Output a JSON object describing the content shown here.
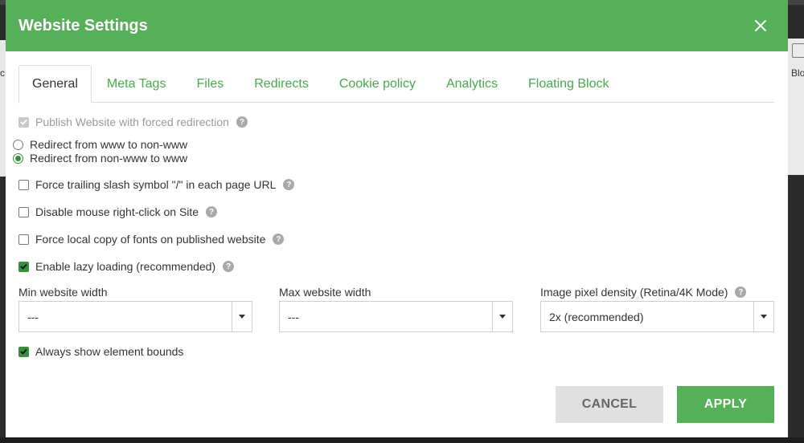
{
  "background": {
    "left_fragment": "c",
    "right_fragment": "Blo"
  },
  "modal": {
    "title": "Website Settings",
    "tabs": [
      {
        "label": "General"
      },
      {
        "label": "Meta Tags"
      },
      {
        "label": "Files"
      },
      {
        "label": "Redirects"
      },
      {
        "label": "Cookie policy"
      },
      {
        "label": "Analytics"
      },
      {
        "label": "Floating Block"
      }
    ],
    "active_tab": "General"
  },
  "general": {
    "publish_forced_redirection": {
      "label": "Publish Website with forced redirection",
      "checked": true,
      "disabled": true
    },
    "redirect_options": [
      {
        "label": "Redirect from www to non-www",
        "selected": false
      },
      {
        "label": "Redirect from non-www to www",
        "selected": true
      }
    ],
    "trailing_slash": {
      "label": "Force trailing slash symbol \"/\" in each page URL",
      "checked": false
    },
    "disable_right_click": {
      "label": "Disable mouse right-click on Site",
      "checked": false
    },
    "local_fonts": {
      "label": "Force local copy of fonts on published website",
      "checked": false
    },
    "lazy_loading": {
      "label": "Enable lazy loading (recommended)",
      "checked": true
    },
    "min_width": {
      "label": "Min website width",
      "value": "---"
    },
    "max_width": {
      "label": "Max website width",
      "value": "---"
    },
    "pixel_density": {
      "label": "Image pixel density (Retina/4K Mode)",
      "value": "2x (recommended)"
    },
    "element_bounds": {
      "label": "Always show element bounds",
      "checked": true
    }
  },
  "buttons": {
    "cancel": "CANCEL",
    "apply": "APPLY"
  },
  "colors": {
    "accent": "#56b05a",
    "checkbox": "#3a8f3e",
    "cancel_bg": "#e0e0e0"
  }
}
